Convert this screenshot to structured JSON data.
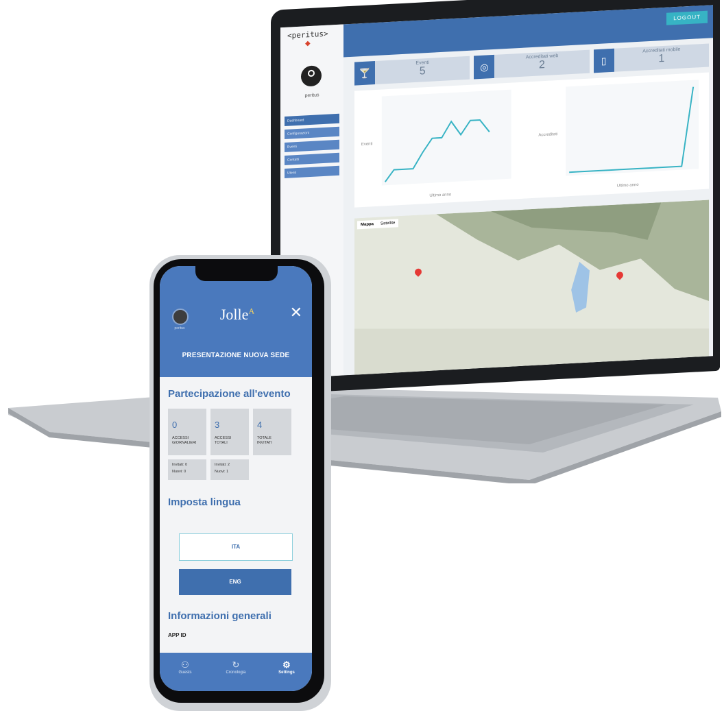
{
  "laptop": {
    "logo": "<peritus>",
    "username": "peritus",
    "logout_label": "LOGOUT",
    "nav": [
      {
        "label": "Dashboard",
        "icon": "dashboard-icon"
      },
      {
        "label": "Configurazioni",
        "icon": "wrench-icon"
      },
      {
        "label": "Eventi",
        "icon": "cocktail-icon"
      },
      {
        "label": "Contatti",
        "icon": "users-icon"
      },
      {
        "label": "Utenti",
        "icon": "user-icon"
      }
    ],
    "cards": [
      {
        "label": "Eventi",
        "value": "5",
        "icon": "cocktail-icon"
      },
      {
        "label": "Accreditati web",
        "value": "2",
        "icon": "globe-icon"
      },
      {
        "label": "Accreditati mobile",
        "value": "1",
        "icon": "tablet-icon"
      }
    ],
    "charts": [
      {
        "ylabel": "Eventi",
        "xlabel": "Ultimo anno"
      },
      {
        "ylabel": "Accreditati",
        "xlabel": "Ultimo anno"
      }
    ],
    "map": {
      "tabs": [
        "Mappa",
        "Satellite"
      ]
    }
  },
  "phone": {
    "avatar_label": "peritus",
    "logo_main": "Jolle",
    "logo_sup": "A",
    "event_title": "PRESENTAZIONE NUOVA SEDE",
    "section_participation": "Partecipazione all'evento",
    "stats": [
      {
        "value": "0",
        "label1": "ACCESSI",
        "label2": "GIORNALIERI"
      },
      {
        "value": "3",
        "label1": "ACCESSI",
        "label2": "TOTALI"
      },
      {
        "value": "4",
        "label1": "TOTALE",
        "label2": "INVITATI"
      }
    ],
    "sub_stats": [
      {
        "line1": "Invitati: 0",
        "line2": "Nuovi: 0"
      },
      {
        "line1": "Invitati: 2",
        "line2": "Nuovi: 1"
      }
    ],
    "section_language": "Imposta lingua",
    "lang_ita": "ITA",
    "lang_eng": "ENG",
    "section_info": "Informazioni generali",
    "info_label": "APP ID",
    "tabs": [
      {
        "label": "Guests",
        "icon": "guests-icon"
      },
      {
        "label": "Cronologia",
        "icon": "history-icon"
      },
      {
        "label": "Settings",
        "icon": "gear-icon"
      }
    ]
  }
}
